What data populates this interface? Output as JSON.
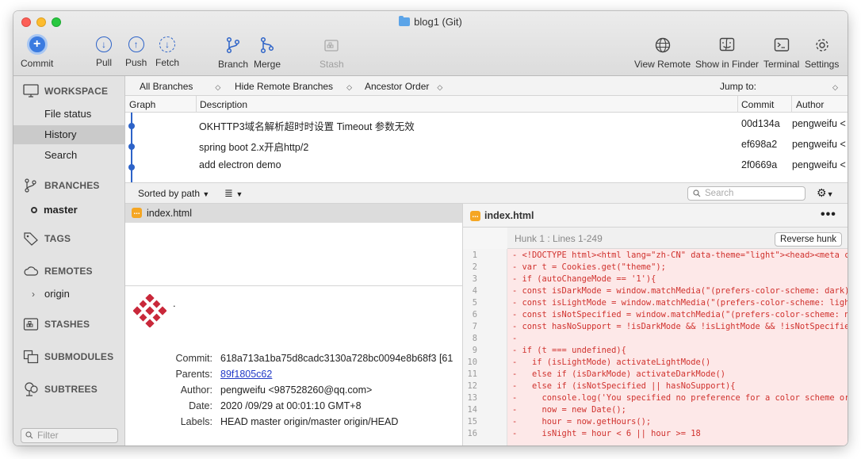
{
  "window": {
    "title": "blog1 (Git)"
  },
  "toolbar": {
    "commit": "Commit",
    "pull": "Pull",
    "push": "Push",
    "fetch": "Fetch",
    "branch": "Branch",
    "merge": "Merge",
    "stash": "Stash",
    "view_remote": "View Remote",
    "show_in_finder": "Show in Finder",
    "terminal": "Terminal",
    "settings": "Settings"
  },
  "sidebar": {
    "workspace": "WORKSPACE",
    "file_status": "File status",
    "history": "History",
    "search": "Search",
    "branches": "BRANCHES",
    "master": "master",
    "tags": "TAGS",
    "remotes": "REMOTES",
    "origin": "origin",
    "stashes": "STASHES",
    "submodules": "SUBMODULES",
    "subtrees": "SUBTREES",
    "filter_placeholder": "Filter"
  },
  "filterbar": {
    "branches": "All Branches",
    "remote": "Hide Remote Branches",
    "order": "Ancestor Order",
    "jump": "Jump to:"
  },
  "history": {
    "columns": {
      "graph": "Graph",
      "description": "Description",
      "commit": "Commit",
      "author": "Author"
    },
    "rows": [
      {
        "description": "OKHTTP3域名解析超时时设置 Timeout 参数无效",
        "commit": "00d134a",
        "author": "pengweifu <"
      },
      {
        "description": "spring boot 2.x开启http/2",
        "commit": "ef698a2",
        "author": "pengweifu <"
      },
      {
        "description": "add electron demo",
        "commit": "2f0669a",
        "author": "pengweifu <"
      }
    ]
  },
  "files": {
    "sort_label": "Sorted by path",
    "search_placeholder": "Search",
    "items": [
      {
        "name": "index.html",
        "badge": "..."
      }
    ]
  },
  "commit_info": {
    "subject": ".",
    "labels": {
      "commit": "Commit:",
      "parents": "Parents:",
      "author": "Author:",
      "date": "Date:",
      "tags": "Labels:"
    },
    "commit": "618a713a1ba75d8cadc3130a728bc0094e8b68f3 [61",
    "parents": "89f1805c62",
    "author": "pengweifu <987528260@qq.com>",
    "date": "2020 /09/29 at 00:01:10 GMT+8",
    "tags": "HEAD master origin/master origin/HEAD"
  },
  "diff": {
    "file": "index.html",
    "hunk": "Hunk 1 : Lines 1-249",
    "reverse": "Reverse hunk",
    "lines": [
      {
        "n": "1",
        "code": "- <!DOCTYPE html><html lang=\"zh-CN\" data-theme=\"light\"><head><meta cha"
      },
      {
        "n": "2",
        "code": "- var t = Cookies.get(\"theme\");"
      },
      {
        "n": "3",
        "code": "- if (autoChangeMode == '1'){"
      },
      {
        "n": "4",
        "code": "- const isDarkMode = window.matchMedia(\"(prefers-color-scheme: dark)\")"
      },
      {
        "n": "5",
        "code": "- const isLightMode = window.matchMedia(\"(prefers-color-scheme: light)"
      },
      {
        "n": "6",
        "code": "- const isNotSpecified = window.matchMedia(\"(prefers-color-scheme: no-"
      },
      {
        "n": "7",
        "code": "- const hasNoSupport = !isDarkMode && !isLightMode && !isNotSpecified"
      },
      {
        "n": "8",
        "code": "-"
      },
      {
        "n": "9",
        "code": "- if (t === undefined){"
      },
      {
        "n": "10",
        "code": "-   if (isLightMode) activateLightMode()"
      },
      {
        "n": "11",
        "code": "-   else if (isDarkMode) activateDarkMode()"
      },
      {
        "n": "12",
        "code": "-   else if (isNotSpecified || hasNoSupport){"
      },
      {
        "n": "13",
        "code": "-     console.log('You specified no preference for a color scheme or y"
      },
      {
        "n": "14",
        "code": "-     now = new Date();"
      },
      {
        "n": "15",
        "code": "-     hour = now.getHours();"
      },
      {
        "n": "16",
        "code": "-     isNight = hour < 6 || hour >= 18"
      }
    ]
  }
}
